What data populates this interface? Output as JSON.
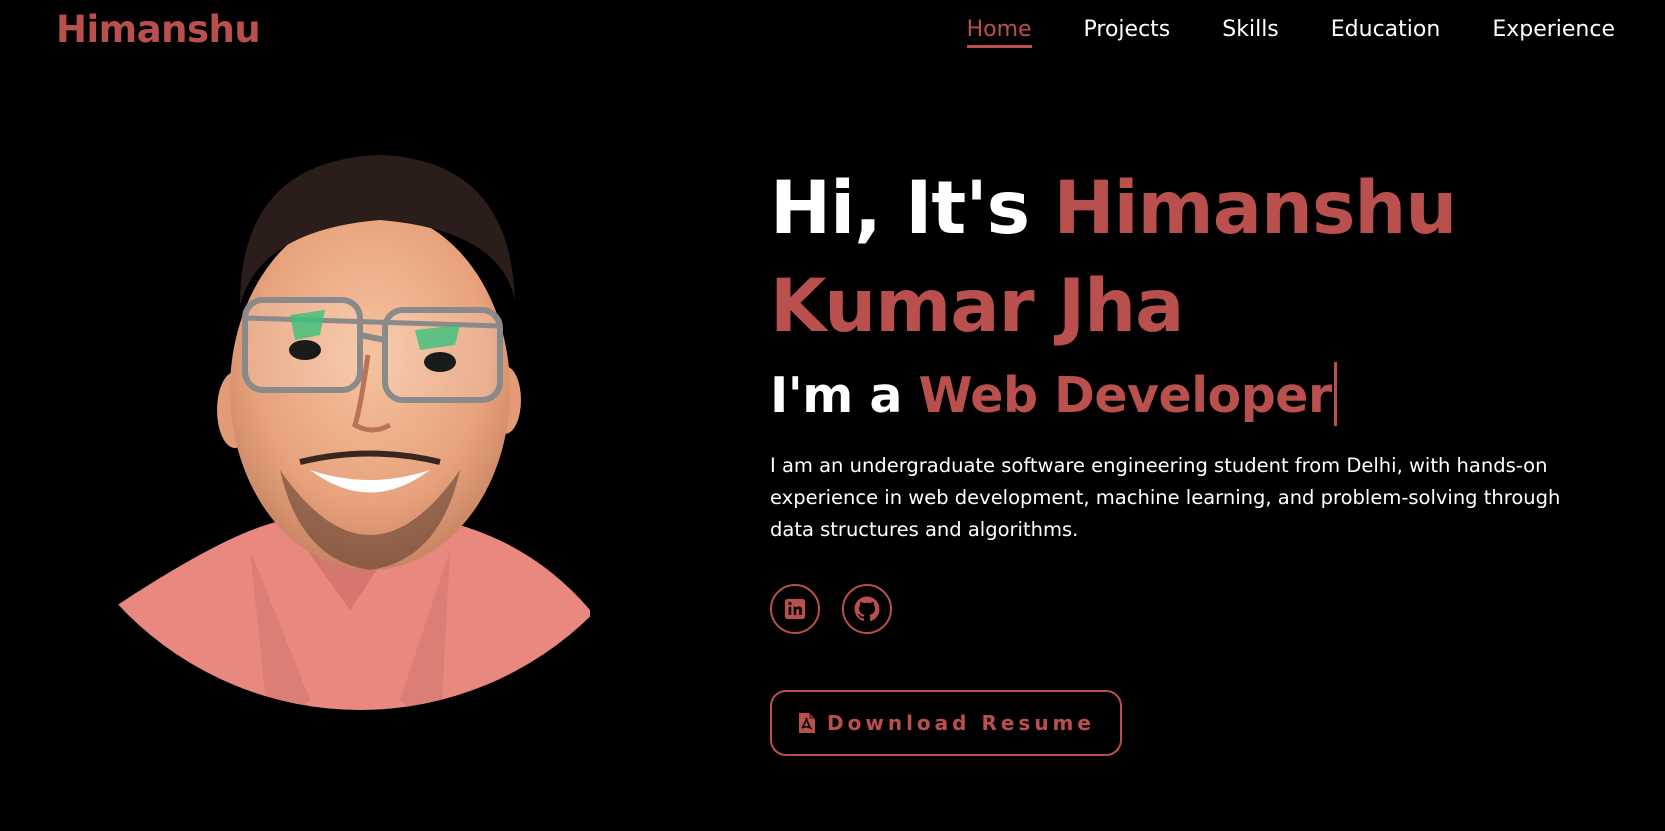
{
  "brand": {
    "logo_text": "Himanshu"
  },
  "nav": {
    "items": [
      {
        "label": "Home",
        "active": true
      },
      {
        "label": "Projects",
        "active": false
      },
      {
        "label": "Skills",
        "active": false
      },
      {
        "label": "Education",
        "active": false
      },
      {
        "label": "Experience",
        "active": false
      }
    ]
  },
  "hero": {
    "greeting": "Hi, It's ",
    "name_part1": "Himanshu",
    "name_part2": "Kumar Jha",
    "role_prefix": "I'm a ",
    "role": "Web Developer",
    "description": "I am an undergraduate software engineering student from Delhi, with hands-on experience in web development, machine learning, and problem-solving through data structures and algorithms.",
    "resume_button": "Download Resume"
  },
  "socials": [
    {
      "icon": "linkedin-icon"
    },
    {
      "icon": "github-icon"
    }
  ],
  "colors": {
    "accent": "#b9504e",
    "background": "#000000",
    "text": "#ffffff"
  }
}
